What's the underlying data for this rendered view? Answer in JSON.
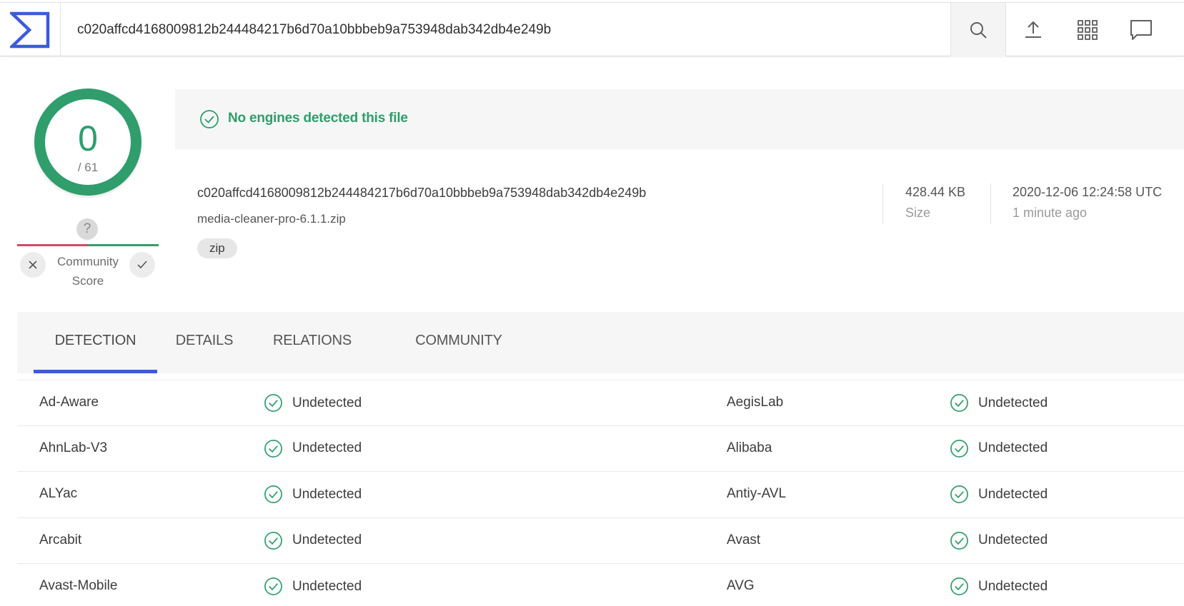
{
  "header": {
    "search_value": "c020affcd4168009812b244484217b6d70a10bbbeb9a753948dab342db4e249b",
    "icons": [
      "search-icon",
      "upload-icon",
      "apps-grid-icon",
      "chat-icon"
    ]
  },
  "score": {
    "detected": "0",
    "total": "/ 61",
    "community_question": "?",
    "community_label": "Community Score"
  },
  "banner": {
    "message": "No engines detected this file"
  },
  "file": {
    "hash": "c020affcd4168009812b244484217b6d70a10bbbeb9a753948dab342db4e249b",
    "name": "media-cleaner-pro-6.1.1.zip",
    "tag": "zip",
    "size_value": "428.44 KB",
    "size_label": "Size",
    "date_value": "2020-12-06 12:24:58 UTC",
    "date_label": "1 minute ago"
  },
  "tabs": [
    {
      "label": "DETECTION",
      "active": true
    },
    {
      "label": "DETAILS",
      "active": false
    },
    {
      "label": "RELATIONS",
      "active": false
    },
    {
      "label": "COMMUNITY",
      "active": false
    }
  ],
  "detections": [
    {
      "left_engine": "Ad-Aware",
      "left_result": "Undetected",
      "right_engine": "AegisLab",
      "right_result": "Undetected"
    },
    {
      "left_engine": "AhnLab-V3",
      "left_result": "Undetected",
      "right_engine": "Alibaba",
      "right_result": "Undetected"
    },
    {
      "left_engine": "ALYac",
      "left_result": "Undetected",
      "right_engine": "Antiy-AVL",
      "right_result": "Undetected"
    },
    {
      "left_engine": "Arcabit",
      "left_result": "Undetected",
      "right_engine": "Avast",
      "right_result": "Undetected"
    },
    {
      "left_engine": "Avast-Mobile",
      "left_result": "Undetected",
      "right_engine": "AVG",
      "right_result": "Undetected"
    }
  ],
  "colors": {
    "clean": "#2f9e6c",
    "accent": "#3b5bdb",
    "malicious": "#d9466a"
  }
}
